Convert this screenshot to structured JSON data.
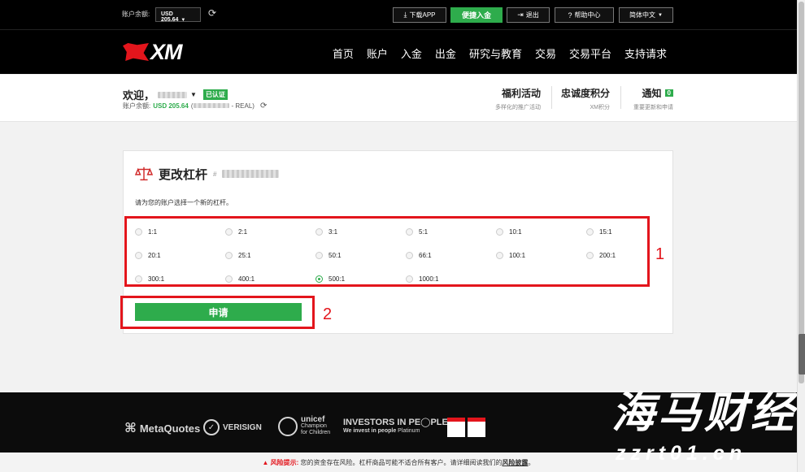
{
  "topbar": {
    "balance_label": "账户余额:",
    "balance_select": "USD 205.64",
    "download_app": "下载APP",
    "quick_deposit": "便捷入金",
    "logout": "退出",
    "help": "帮助中心",
    "language": "简体中文"
  },
  "nav": {
    "logo": "XM",
    "items": [
      "首页",
      "账户",
      "入金",
      "出金",
      "研究与教育",
      "交易",
      "交易平台",
      "支持请求"
    ]
  },
  "account": {
    "welcome": "欢迎，",
    "verified": "已认证",
    "balance_label": "账户余额:",
    "balance_value": "USD 205.64",
    "balance_type": "- REAL)",
    "promotions_title": "福利活动",
    "promotions_sub": "多样化的推广活动",
    "loyalty_title": "忠诚度积分",
    "loyalty_sub": "XM积分",
    "notify_title": "通知",
    "notify_count": "0",
    "notify_sub": "重要更新和申请"
  },
  "leverage": {
    "title": "更改杠杆",
    "instruction": "请为您的账户选择一个新的杠杆。",
    "options": [
      "1:1",
      "2:1",
      "3:1",
      "5:1",
      "10:1",
      "15:1",
      "20:1",
      "25:1",
      "50:1",
      "66:1",
      "100:1",
      "200:1",
      "300:1",
      "400:1",
      "500:1",
      "1000:1"
    ],
    "selected": "500:1",
    "submit": "申请"
  },
  "annotations": {
    "box1": "1",
    "box2": "2"
  },
  "footer": {
    "partners": [
      "MetaQuotes",
      "VERISIGN",
      "unicef",
      "Champion",
      "for Children",
      "INVESTORS IN PE◯PLE",
      "We invest in people",
      "Platinum"
    ],
    "risk_label": "风险提示:",
    "risk_text": " 您的资金存在风险。杠杆商品可能不适合所有客户。请详细阅读我们的",
    "risk_link": "风险披露",
    "risk_end": "。"
  },
  "watermark": {
    "title": "海马财经",
    "url": "zzrt01.cn"
  },
  "colors": {
    "brand_green": "#2eac4c",
    "brand_red": "#e3151c",
    "nav_bg": "#000000"
  }
}
